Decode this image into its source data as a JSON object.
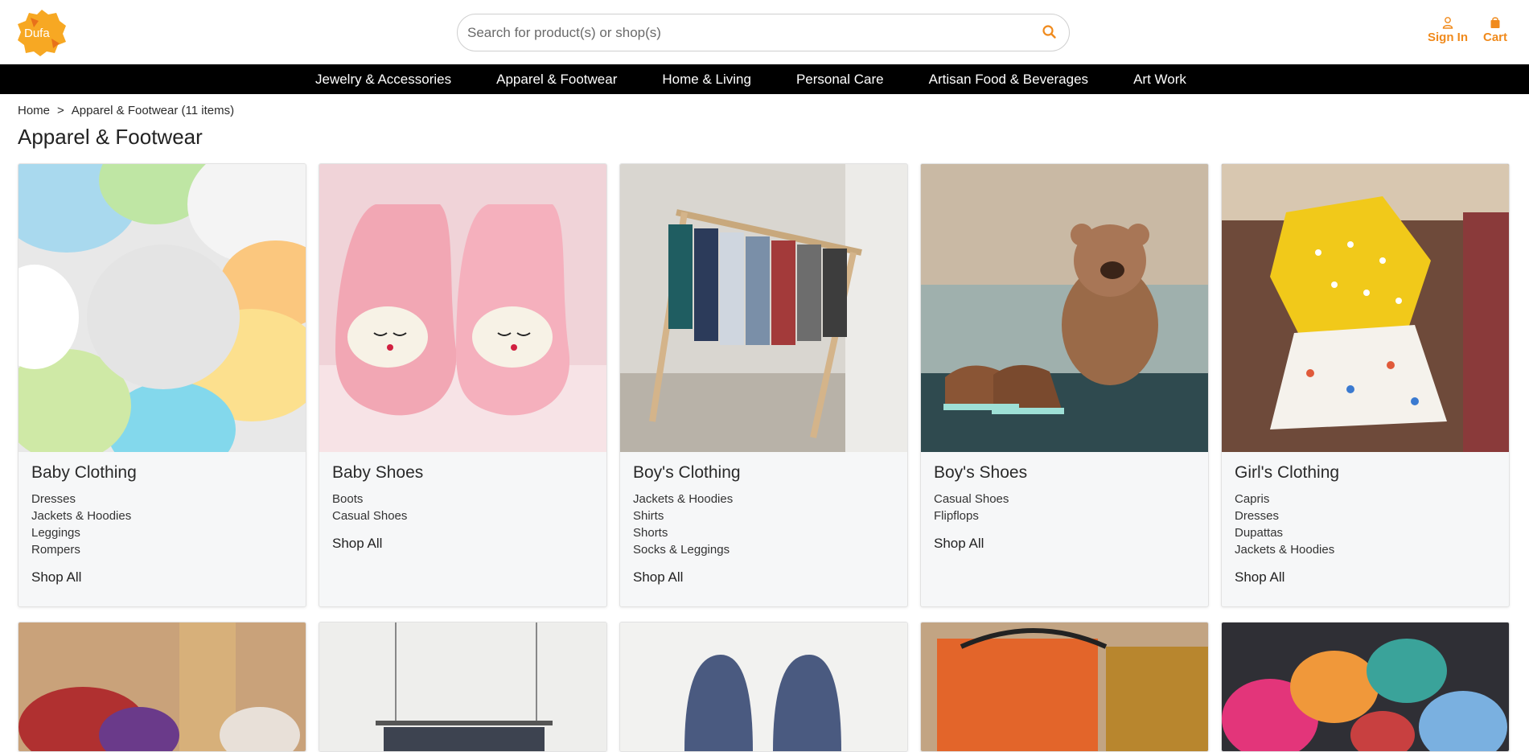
{
  "header": {
    "logo_text": "Dufa",
    "search_placeholder": "Search for product(s) or shop(s)",
    "signin_label": "Sign In",
    "cart_label": "Cart",
    "accent_color": "#f08a1c"
  },
  "nav": {
    "items": [
      "Jewelry & Accessories",
      "Apparel & Footwear",
      "Home & Living",
      "Personal Care",
      "Artisan Food & Beverages",
      "Art Work"
    ]
  },
  "breadcrumb": {
    "home": "Home",
    "separator": ">",
    "current": "Apparel & Footwear (11 items)"
  },
  "page_title": "Apparel & Footwear",
  "categories": [
    {
      "title": "Baby Clothing",
      "subs": [
        "Dresses",
        "Jackets & Hoodies",
        "Leggings",
        "Rompers"
      ],
      "shop_all": "Shop All"
    },
    {
      "title": "Baby Shoes",
      "subs": [
        "Boots",
        "Casual Shoes"
      ],
      "shop_all": "Shop All"
    },
    {
      "title": "Boy's Clothing",
      "subs": [
        "Jackets & Hoodies",
        "Shirts",
        "Shorts",
        "Socks & Leggings"
      ],
      "shop_all": "Shop All"
    },
    {
      "title": "Boy's Shoes",
      "subs": [
        "Casual Shoes",
        "Flipflops"
      ],
      "shop_all": "Shop All"
    },
    {
      "title": "Girl's Clothing",
      "subs": [
        "Capris",
        "Dresses",
        "Dupattas",
        "Jackets & Hoodies"
      ],
      "shop_all": "Shop All"
    }
  ]
}
